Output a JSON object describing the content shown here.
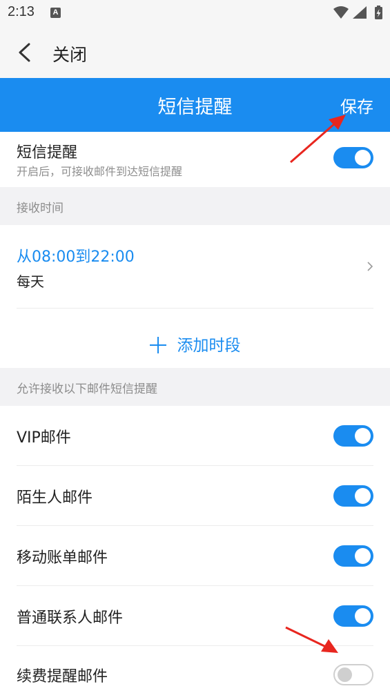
{
  "status_bar": {
    "time": "2:13",
    "notification_icon": "A"
  },
  "close_bar": {
    "close_label": "关闭"
  },
  "title_bar": {
    "title": "短信提醒",
    "save_label": "保存"
  },
  "sms_toggle_row": {
    "label": "短信提醒",
    "description": "开启后，可接收邮件到达短信提醒",
    "enabled": true
  },
  "receive_time": {
    "header": "接收时间",
    "period": {
      "range": "从08:00到22:00",
      "days": "每天"
    },
    "add_label": "添加时段"
  },
  "mail_types": {
    "header": "允许接收以下邮件短信提醒",
    "items": [
      {
        "label": "VIP邮件",
        "enabled": true
      },
      {
        "label": "陌生人邮件",
        "enabled": true
      },
      {
        "label": "移动账单邮件",
        "enabled": true
      },
      {
        "label": "普通联系人邮件",
        "enabled": true
      },
      {
        "label": "续费提醒邮件",
        "enabled": false
      }
    ]
  },
  "colors": {
    "accent": "#1a8cf0",
    "annotation_arrow": "#e8261f"
  }
}
